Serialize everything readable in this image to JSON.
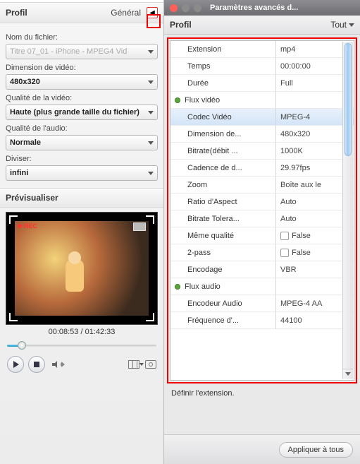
{
  "left": {
    "profile_label": "Profil",
    "profile_menu": "Général",
    "filename_label": "Nom du fichier:",
    "filename_value": "Titre 07_01 - iPhone - MPEG4 Vid",
    "dimension_label": "Dimension de vidéo:",
    "dimension_value": "480x320",
    "vq_label": "Qualité de la vidéo:",
    "vq_value": "Haute (plus grande taille du fichier)",
    "aq_label": "Qualité de l'audio:",
    "aq_value": "Normale",
    "split_label": "Diviser:",
    "split_value": "infini",
    "preview_label": "Prévisualiser",
    "rec": "REC",
    "time": "00:08:53 / 01:42:33"
  },
  "right": {
    "window_title": "Paramètres avancés d...",
    "profile_label": "Profil",
    "profile_menu": "Tout",
    "rows": [
      {
        "k": "Extension",
        "v": "mp4"
      },
      {
        "k": "Temps",
        "v": "00:00:00"
      },
      {
        "k": "Durée",
        "v": "Full"
      },
      {
        "k": "Flux vidéo",
        "v": "",
        "group": true
      },
      {
        "k": "Codec Vidéo",
        "v": "MPEG-4",
        "sel": true
      },
      {
        "k": "Dimension de...",
        "v": "480x320"
      },
      {
        "k": "Bitrate(débit ...",
        "v": "1000K"
      },
      {
        "k": "Cadence de d...",
        "v": "29.97fps"
      },
      {
        "k": "Zoom",
        "v": "Boîte aux le"
      },
      {
        "k": "Ratio d'Aspect",
        "v": "Auto"
      },
      {
        "k": "Bitrate Tolera...",
        "v": "Auto"
      },
      {
        "k": "Même qualité",
        "v": "False",
        "chk": true
      },
      {
        "k": "2-pass",
        "v": "False",
        "chk": true
      },
      {
        "k": "Encodage",
        "v": "VBR"
      },
      {
        "k": "Flux audio",
        "v": "",
        "group": true
      },
      {
        "k": "Encodeur Audio",
        "v": "MPEG-4 AA"
      },
      {
        "k": "Fréquence d'...",
        "v": "44100"
      }
    ],
    "status": "Définir l'extension.",
    "apply": "Appliquer à tous"
  }
}
